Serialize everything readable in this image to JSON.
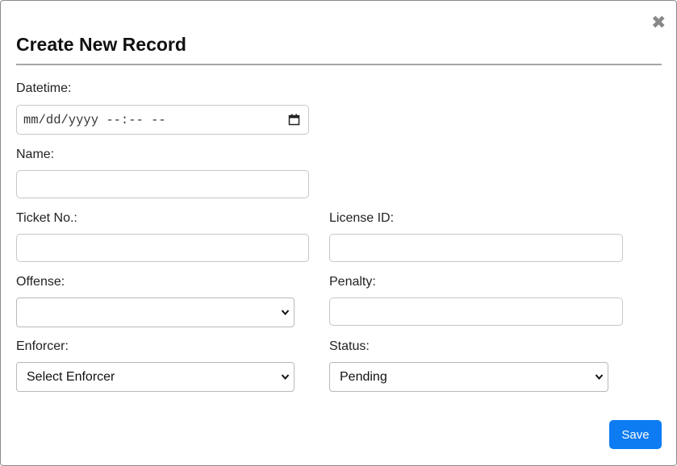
{
  "dialog": {
    "title": "Create New Record",
    "close_icon": "close-icon"
  },
  "fields": {
    "datetime": {
      "label": "Datetime:",
      "placeholder": "mm/dd/yyyy --:-- --",
      "value": ""
    },
    "name": {
      "label": "Name:",
      "value": ""
    },
    "ticket_no": {
      "label": "Ticket No.:",
      "value": ""
    },
    "license_id": {
      "label": "License ID:",
      "value": ""
    },
    "offense": {
      "label": "Offense:",
      "selected": ""
    },
    "penalty": {
      "label": "Penalty:",
      "value": ""
    },
    "enforcer": {
      "label": "Enforcer:",
      "selected": "Select Enforcer"
    },
    "status": {
      "label": "Status:",
      "selected": "Pending"
    }
  },
  "actions": {
    "save_label": "Save"
  },
  "colors": {
    "accent": "#0d7cf2",
    "border": "#c7c7c7",
    "rule": "#a6a6a6",
    "close": "#888888"
  }
}
